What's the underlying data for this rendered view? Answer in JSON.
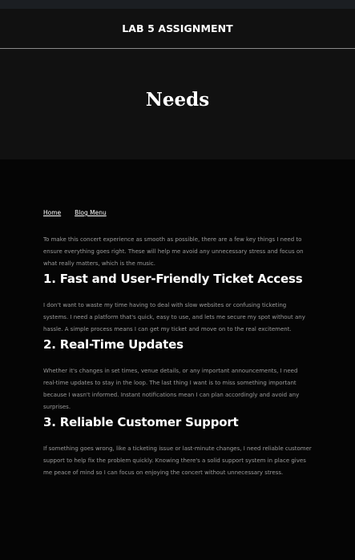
{
  "header": {
    "site_title": "LAB 5 ASSIGNMENT"
  },
  "hero": {
    "title": "Needs"
  },
  "nav": {
    "home": "Home",
    "blog_menu": "Blog Menu"
  },
  "content": {
    "intro": "To make this concert experience as smooth as possible, there are a few key things I need to ensure everything goes right. These will help me avoid any unnecessary stress and focus on what really matters, which is the music.",
    "sections": [
      {
        "heading": "1. Fast and User-Friendly Ticket Access",
        "text": "I don't want to waste my time having to deal with slow websites or confusing ticketing systems. I need a platform that's quick, easy to use, and lets me secure my spot without any hassle. A simple process means I can get my ticket and move on to the real excitement."
      },
      {
        "heading": "2. Real-Time Updates",
        "text": "Whether it's changes in set times, venue details, or any important announcements, I need real-time updates to stay in the loop. The last thing I want is to miss something important because I wasn't informed. Instant notifications mean I can plan accordingly and avoid any surprises."
      },
      {
        "heading": "3. Reliable Customer Support",
        "text": "If something goes wrong, like a ticketing issue or last-minute changes, I need reliable customer support to help fix the problem quickly. Knowing there's a solid support system in place gives me peace of mind so I can focus on enjoying the concert without unnecessary stress."
      }
    ]
  },
  "colors": {
    "background": "#050505",
    "header_bg": "#111111",
    "top_strip": "#1b1e22",
    "heading_text": "#ffffff",
    "body_text": "#9a9a9a"
  }
}
